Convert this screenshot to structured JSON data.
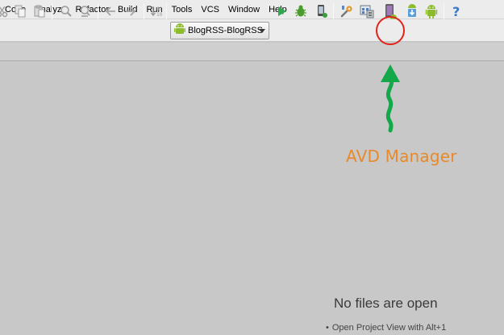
{
  "menubar": {
    "items": [
      "Code",
      "Analyze",
      "Refactor",
      "Build",
      "Run",
      "Tools",
      "VCS",
      "Window",
      "Help"
    ]
  },
  "toolbar": {
    "run_config": "BlogRSS-BlogRSS",
    "icons": [
      "cut-icon",
      "copy-icon",
      "paste-icon",
      "find-icon",
      "replace-icon",
      "back-icon",
      "forward-icon",
      "make-project-icon",
      "run-icon",
      "debug-icon",
      "attach-debugger-icon",
      "settings-icon",
      "project-structure-icon",
      "avd-manager-icon",
      "sdk-manager-icon",
      "android-monitor-icon",
      "help-icon"
    ]
  },
  "annotation": {
    "label": "AVD Manager",
    "circle_color": "#e0231b",
    "arrow_color": "#13a84a",
    "label_color": "#e8892a"
  },
  "editor": {
    "empty_title": "No files are open",
    "hint": "Open Project View with Alt+1"
  }
}
